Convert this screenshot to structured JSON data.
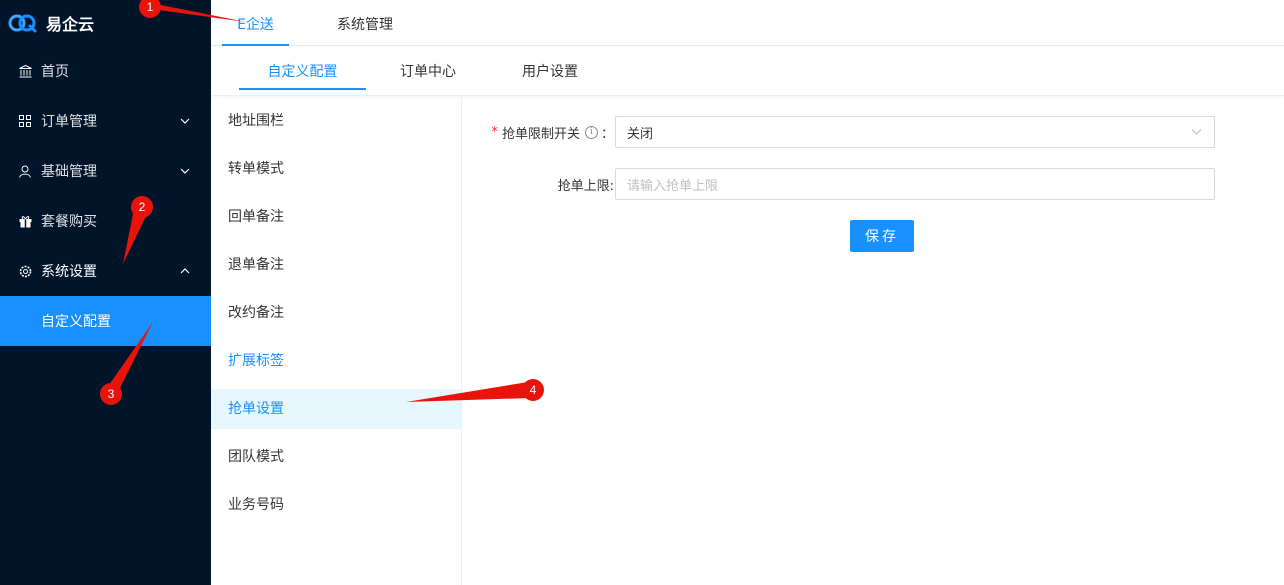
{
  "app": {
    "name": "易企云"
  },
  "sidebar": {
    "items": [
      {
        "label": "首页",
        "icon": "bank-icon"
      },
      {
        "label": "订单管理",
        "icon": "grid-icon",
        "arrow": "chevron-down-icon"
      },
      {
        "label": "基础管理",
        "icon": "user-icon",
        "arrow": "chevron-down-icon"
      },
      {
        "label": "套餐购买",
        "icon": "gift-icon"
      },
      {
        "label": "系统设置",
        "icon": "gear-icon",
        "arrow": "chevron-up-icon"
      }
    ],
    "sub_item": {
      "label": "自定义配置"
    }
  },
  "top_tabs": [
    {
      "label": "E企送"
    },
    {
      "label": "系统管理"
    }
  ],
  "sub_tabs": [
    {
      "label": "自定义配置"
    },
    {
      "label": "订单中心"
    },
    {
      "label": "用户设置"
    }
  ],
  "settings_menu": [
    {
      "label": "地址围栏"
    },
    {
      "label": "转单模式"
    },
    {
      "label": "回单备注"
    },
    {
      "label": "退单备注"
    },
    {
      "label": "改约备注"
    },
    {
      "label": "扩展标签"
    },
    {
      "label": "抢单设置"
    },
    {
      "label": "团队模式"
    },
    {
      "label": "业务号码"
    }
  ],
  "form": {
    "limit_switch": {
      "required_mark": "*",
      "label": "抢单限制开关",
      "colon": "：",
      "value": "关闭"
    },
    "limit_max": {
      "label": "抢单上限:",
      "placeholder": "请输入抢单上限"
    },
    "save_label": "保存"
  },
  "annotations": [
    "1",
    "2",
    "3",
    "4"
  ],
  "colors": {
    "sidebar_bg": "#001529",
    "accent": "#1890ff",
    "annotation": "#e8140c"
  }
}
